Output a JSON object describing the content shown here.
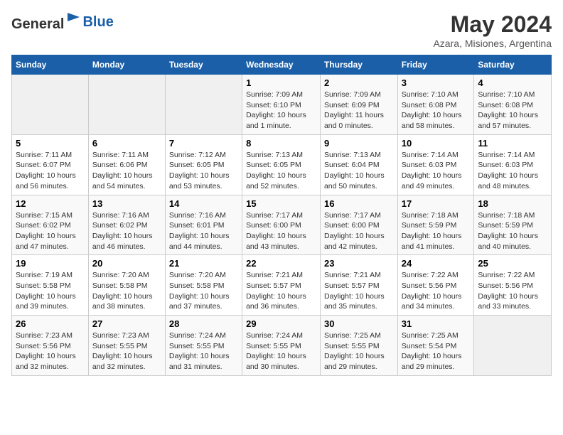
{
  "header": {
    "logo_general": "General",
    "logo_blue": "Blue",
    "month_year": "May 2024",
    "location": "Azara, Misiones, Argentina"
  },
  "days_of_week": [
    "Sunday",
    "Monday",
    "Tuesday",
    "Wednesday",
    "Thursday",
    "Friday",
    "Saturday"
  ],
  "weeks": [
    [
      {
        "num": "",
        "info": ""
      },
      {
        "num": "",
        "info": ""
      },
      {
        "num": "",
        "info": ""
      },
      {
        "num": "1",
        "info": "Sunrise: 7:09 AM\nSunset: 6:10 PM\nDaylight: 10 hours\nand 1 minute."
      },
      {
        "num": "2",
        "info": "Sunrise: 7:09 AM\nSunset: 6:09 PM\nDaylight: 11 hours\nand 0 minutes."
      },
      {
        "num": "3",
        "info": "Sunrise: 7:10 AM\nSunset: 6:08 PM\nDaylight: 10 hours\nand 58 minutes."
      },
      {
        "num": "4",
        "info": "Sunrise: 7:10 AM\nSunset: 6:08 PM\nDaylight: 10 hours\nand 57 minutes."
      }
    ],
    [
      {
        "num": "5",
        "info": "Sunrise: 7:11 AM\nSunset: 6:07 PM\nDaylight: 10 hours\nand 56 minutes."
      },
      {
        "num": "6",
        "info": "Sunrise: 7:11 AM\nSunset: 6:06 PM\nDaylight: 10 hours\nand 54 minutes."
      },
      {
        "num": "7",
        "info": "Sunrise: 7:12 AM\nSunset: 6:05 PM\nDaylight: 10 hours\nand 53 minutes."
      },
      {
        "num": "8",
        "info": "Sunrise: 7:13 AM\nSunset: 6:05 PM\nDaylight: 10 hours\nand 52 minutes."
      },
      {
        "num": "9",
        "info": "Sunrise: 7:13 AM\nSunset: 6:04 PM\nDaylight: 10 hours\nand 50 minutes."
      },
      {
        "num": "10",
        "info": "Sunrise: 7:14 AM\nSunset: 6:03 PM\nDaylight: 10 hours\nand 49 minutes."
      },
      {
        "num": "11",
        "info": "Sunrise: 7:14 AM\nSunset: 6:03 PM\nDaylight: 10 hours\nand 48 minutes."
      }
    ],
    [
      {
        "num": "12",
        "info": "Sunrise: 7:15 AM\nSunset: 6:02 PM\nDaylight: 10 hours\nand 47 minutes."
      },
      {
        "num": "13",
        "info": "Sunrise: 7:16 AM\nSunset: 6:02 PM\nDaylight: 10 hours\nand 46 minutes."
      },
      {
        "num": "14",
        "info": "Sunrise: 7:16 AM\nSunset: 6:01 PM\nDaylight: 10 hours\nand 44 minutes."
      },
      {
        "num": "15",
        "info": "Sunrise: 7:17 AM\nSunset: 6:00 PM\nDaylight: 10 hours\nand 43 minutes."
      },
      {
        "num": "16",
        "info": "Sunrise: 7:17 AM\nSunset: 6:00 PM\nDaylight: 10 hours\nand 42 minutes."
      },
      {
        "num": "17",
        "info": "Sunrise: 7:18 AM\nSunset: 5:59 PM\nDaylight: 10 hours\nand 41 minutes."
      },
      {
        "num": "18",
        "info": "Sunrise: 7:18 AM\nSunset: 5:59 PM\nDaylight: 10 hours\nand 40 minutes."
      }
    ],
    [
      {
        "num": "19",
        "info": "Sunrise: 7:19 AM\nSunset: 5:58 PM\nDaylight: 10 hours\nand 39 minutes."
      },
      {
        "num": "20",
        "info": "Sunrise: 7:20 AM\nSunset: 5:58 PM\nDaylight: 10 hours\nand 38 minutes."
      },
      {
        "num": "21",
        "info": "Sunrise: 7:20 AM\nSunset: 5:58 PM\nDaylight: 10 hours\nand 37 minutes."
      },
      {
        "num": "22",
        "info": "Sunrise: 7:21 AM\nSunset: 5:57 PM\nDaylight: 10 hours\nand 36 minutes."
      },
      {
        "num": "23",
        "info": "Sunrise: 7:21 AM\nSunset: 5:57 PM\nDaylight: 10 hours\nand 35 minutes."
      },
      {
        "num": "24",
        "info": "Sunrise: 7:22 AM\nSunset: 5:56 PM\nDaylight: 10 hours\nand 34 minutes."
      },
      {
        "num": "25",
        "info": "Sunrise: 7:22 AM\nSunset: 5:56 PM\nDaylight: 10 hours\nand 33 minutes."
      }
    ],
    [
      {
        "num": "26",
        "info": "Sunrise: 7:23 AM\nSunset: 5:56 PM\nDaylight: 10 hours\nand 32 minutes."
      },
      {
        "num": "27",
        "info": "Sunrise: 7:23 AM\nSunset: 5:55 PM\nDaylight: 10 hours\nand 32 minutes."
      },
      {
        "num": "28",
        "info": "Sunrise: 7:24 AM\nSunset: 5:55 PM\nDaylight: 10 hours\nand 31 minutes."
      },
      {
        "num": "29",
        "info": "Sunrise: 7:24 AM\nSunset: 5:55 PM\nDaylight: 10 hours\nand 30 minutes."
      },
      {
        "num": "30",
        "info": "Sunrise: 7:25 AM\nSunset: 5:55 PM\nDaylight: 10 hours\nand 29 minutes."
      },
      {
        "num": "31",
        "info": "Sunrise: 7:25 AM\nSunset: 5:54 PM\nDaylight: 10 hours\nand 29 minutes."
      },
      {
        "num": "",
        "info": ""
      }
    ]
  ]
}
